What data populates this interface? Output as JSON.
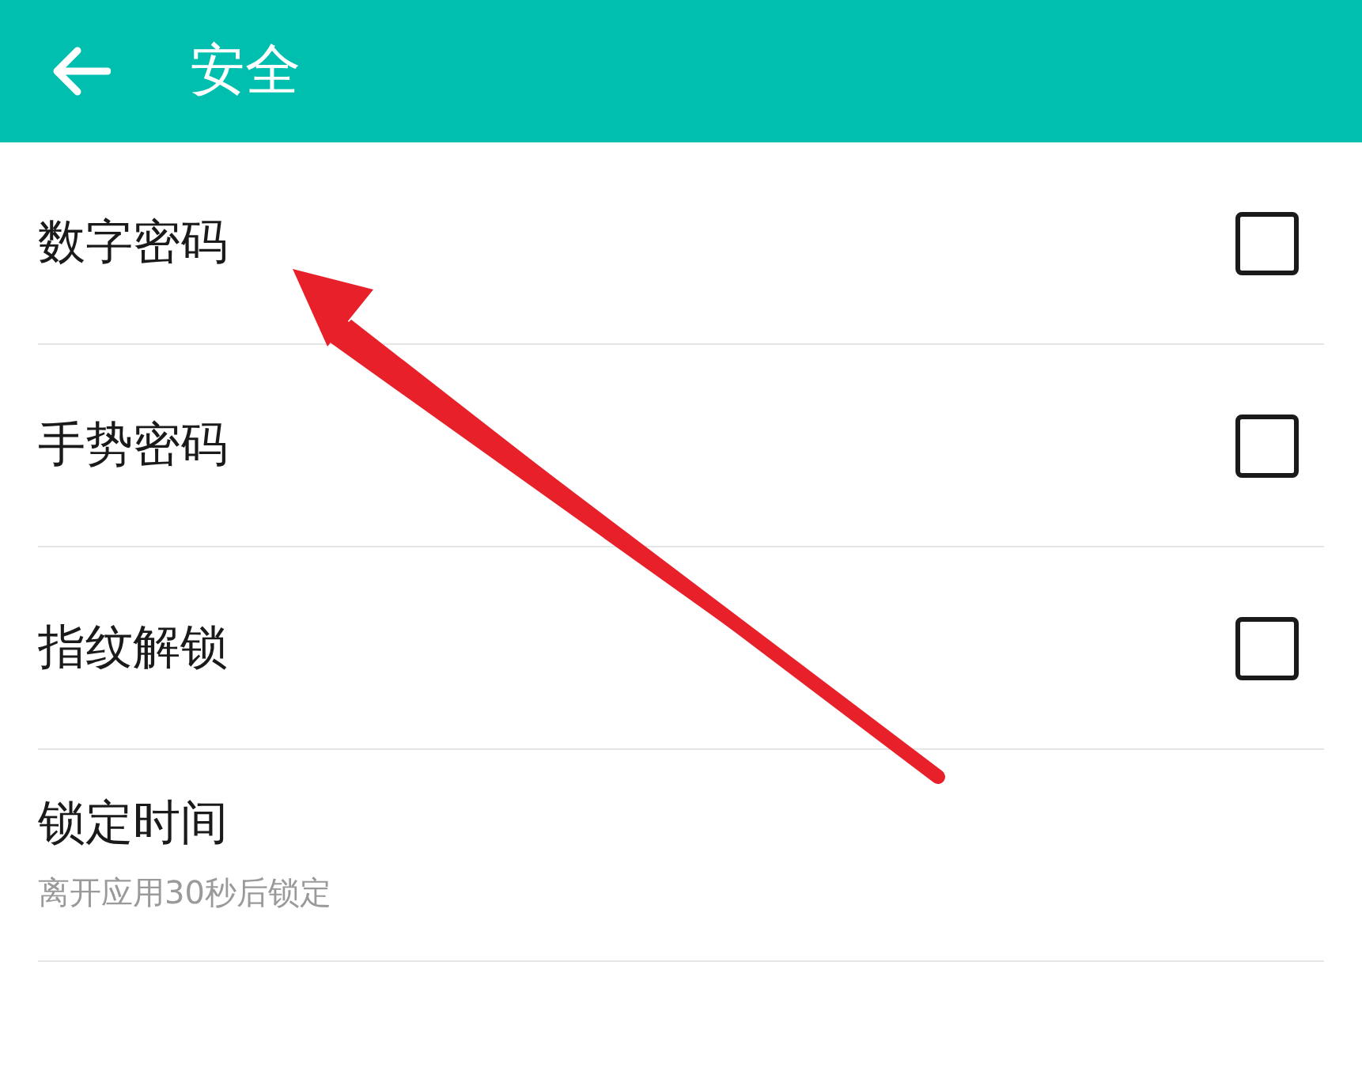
{
  "header": {
    "title": "安全"
  },
  "settings": [
    {
      "kind": "checkbox",
      "label": "数字密码",
      "checked": false
    },
    {
      "kind": "checkbox",
      "label": "手势密码",
      "checked": false
    },
    {
      "kind": "checkbox",
      "label": "指纹解锁",
      "checked": false
    },
    {
      "kind": "info",
      "label": "锁定时间",
      "subtitle": "离开应用30秒后锁定"
    }
  ]
}
